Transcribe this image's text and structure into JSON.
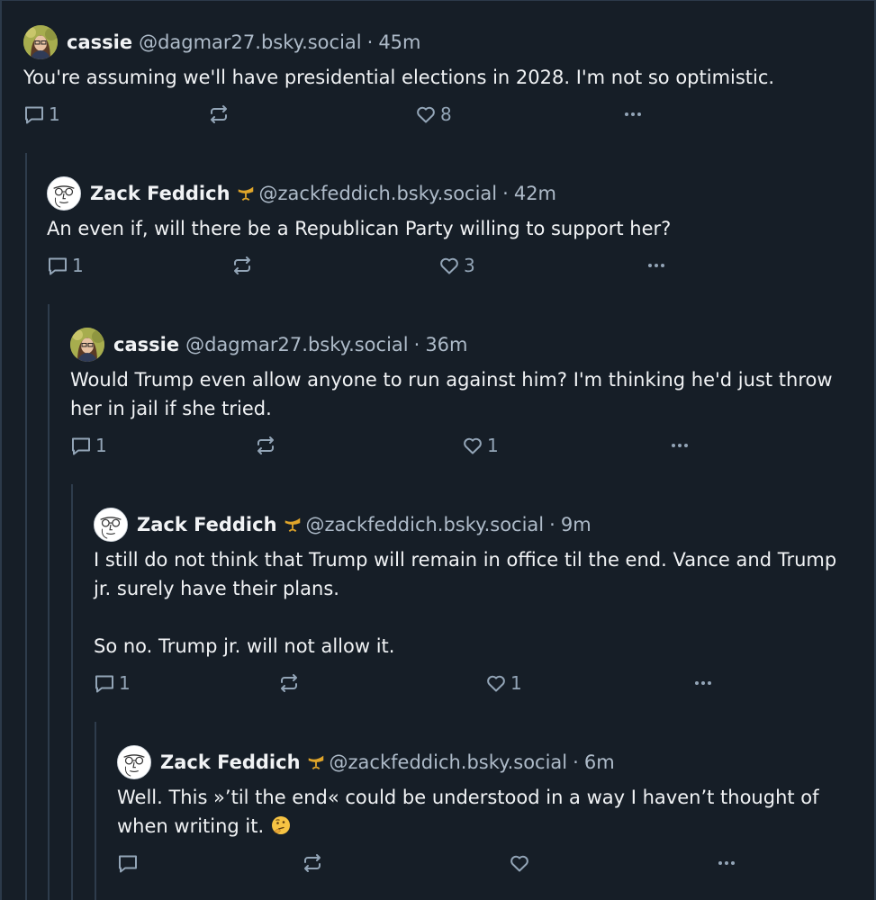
{
  "posts": [
    {
      "name": "cassie",
      "handle": "@dagmar27.bsky.social",
      "separator": "·",
      "time": "45m",
      "text": "You're assuming we'll have presidential elections in 2028. I'm not so optimistic.",
      "replies": "1",
      "reposts": "",
      "likes": "8"
    },
    {
      "name": "Zack Feddich",
      "handle": "@zackfeddich.bsky.social",
      "separator": "·",
      "time": "42m",
      "text": "An even if, will there be a Republican Party willing to support her?",
      "replies": "1",
      "reposts": "",
      "likes": "3"
    },
    {
      "name": "cassie",
      "handle": "@dagmar27.bsky.social",
      "separator": "·",
      "time": "36m",
      "text": "Would Trump even allow anyone to run against him? I'm thinking he'd just throw her in jail if she tried.",
      "replies": "1",
      "reposts": "",
      "likes": "1"
    },
    {
      "name": "Zack Feddich",
      "handle": "@zackfeddich.bsky.social",
      "separator": "·",
      "time": "9m",
      "text": "I still do not think that Trump will remain in office til the end. Vance and Trump jr. surely have their plans.\n\nSo no. Trump jr. will not allow it.",
      "replies": "1",
      "reposts": "",
      "likes": "1"
    },
    {
      "name": "Zack Feddich",
      "handle": "@zackfeddich.bsky.social",
      "separator": "·",
      "time": "6m",
      "text": "Well. This »’til the end« could be understood in a way I haven’t thought of when writing it.",
      "replies": "",
      "reposts": "",
      "likes": ""
    }
  ],
  "icons": {
    "reply": "speech-bubble-icon",
    "repost": "repost-arrows-icon",
    "like": "heart-icon",
    "more": "ellipsis-icon",
    "badge": "horn-badge-icon",
    "emoji": "thinking-face-emoji"
  },
  "colors": {
    "background": "#161e27",
    "text": "#f1f3f5",
    "muted": "#aebbc9",
    "icon": "#93a5b7",
    "thread_line": "#2e3c4c",
    "badge": "#e0a52a"
  }
}
